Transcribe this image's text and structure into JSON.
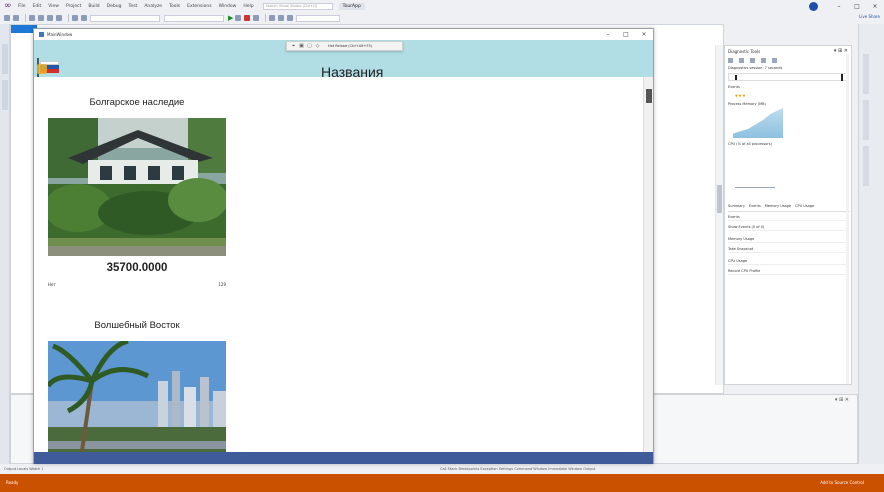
{
  "ide": {
    "menu": [
      "File",
      "Edit",
      "View",
      "Project",
      "Build",
      "Debug",
      "Test",
      "Analyze",
      "Tools",
      "Extensions",
      "Window",
      "Help"
    ],
    "search_placeholder": "Search Visual Studio (Ctrl+Q)",
    "solution_name": "TourApp",
    "live_share": "Live Share",
    "statusline_left": "Output  Locals  Watch 1",
    "statusline_right": "Call Stack  Breakpoints  Exception Settings  Command Window  Immediate Window  Output",
    "status_left": "Ready",
    "status_right": "Add to Source Control"
  },
  "diagnostics": {
    "title": "Diagnostic Tools",
    "session": "Diagnostics session: 7 seconds",
    "events_label": "Events",
    "process_memory_label": "Process Memory (MB)",
    "cpu_label": "CPU (% of all processors)",
    "tabs": [
      "Summary",
      "Events",
      "Memory Usage",
      "CPU Usage"
    ],
    "events_section": "Events",
    "events_item": "Show Events (0 of 0)",
    "memory_section": "Memory Usage",
    "memory_item": "Take Snapshot",
    "cpu_section": "CPU Usage",
    "cpu_item": "Record CPU Profile"
  },
  "app": {
    "window_title": "MainWindow",
    "header_title": "Названия",
    "debug_toolbar_label": "Hot Reload (Ctrl+Alt+F5)",
    "tours": [
      {
        "name": "Болгарское наследие",
        "price": "35700.0000",
        "left_note": "Нет",
        "right_note": "129"
      },
      {
        "name": "Волшебный Восток",
        "price": "",
        "left_note": "",
        "right_note": ""
      }
    ]
  },
  "colors": {
    "app_header": "#b1dde5",
    "app_footer": "#3f5b9a",
    "ide_status": "#ca5100",
    "accent_blue": "#1e78d7"
  }
}
